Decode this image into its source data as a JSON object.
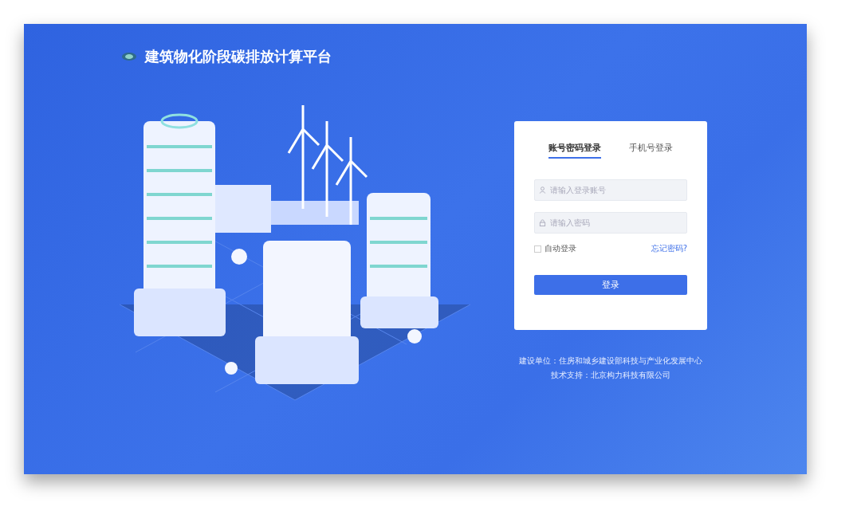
{
  "header": {
    "title": "建筑物化阶段碳排放计算平台"
  },
  "login": {
    "tabs": [
      {
        "label": "账号密码登录",
        "selected": true
      },
      {
        "label": "手机号登录",
        "selected": false
      }
    ],
    "account": {
      "placeholder": "请输入登录账号"
    },
    "password": {
      "placeholder": "请输入密码"
    },
    "remember": {
      "label": "自动登录",
      "checked": false
    },
    "forgot": "忘记密码?",
    "submit": "登录"
  },
  "footer": [
    "建设单位：住房和城乡建设部科技与产业化发展中心",
    "技术支持：北京构力科技有限公司"
  ]
}
